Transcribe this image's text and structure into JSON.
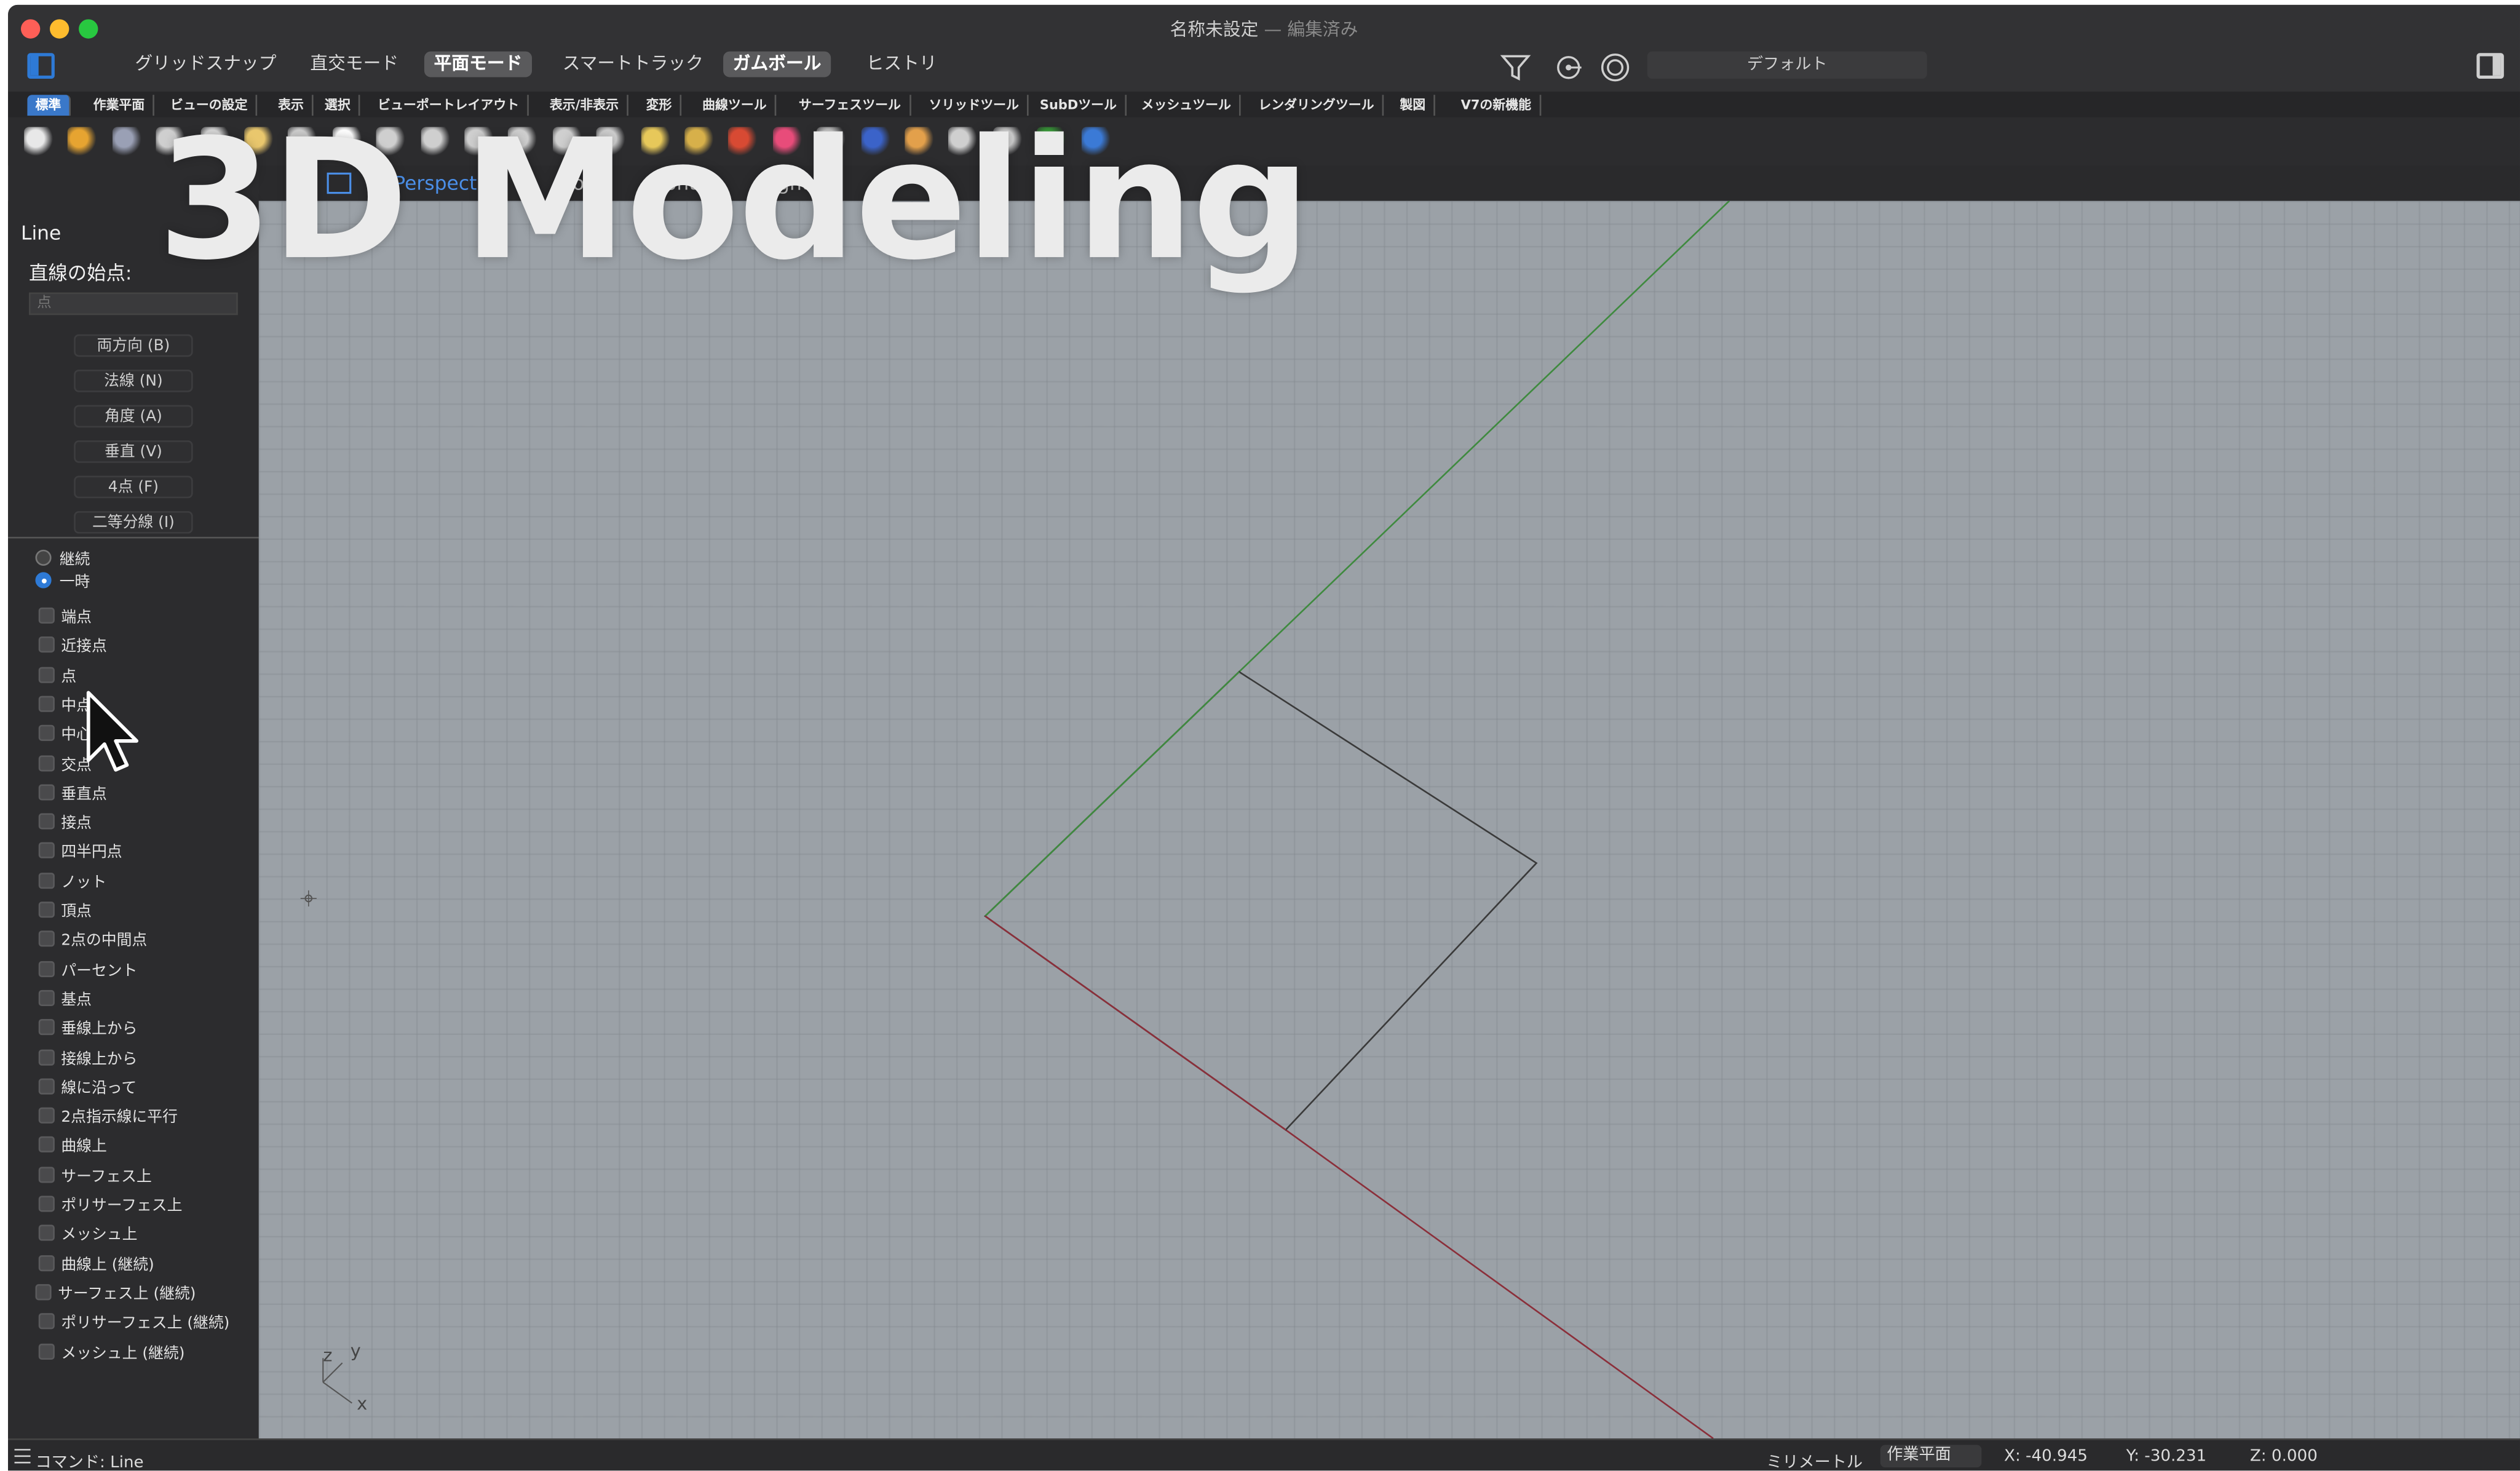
{
  "window": {
    "title": "名称未設定",
    "title_sep": " — ",
    "title_status": "編集済み"
  },
  "toolbar": {
    "grid_snap": "グリッドスナップ",
    "ortho": "直交モード",
    "planar": "平面モード",
    "smart_track": "スマートトラック",
    "gumball": "ガムボール",
    "history": "ヒストリ",
    "layer_default": "デフォルト"
  },
  "tabs": [
    "標準",
    "作業平面",
    "ビューの設定",
    "表示",
    "選択",
    "ビューポートレイアウト",
    "表示/非表示",
    "変形",
    "曲線ツール",
    "サーフェスツール",
    "ソリッドツール",
    "SubDツール",
    "メッシュツール",
    "レンダリングツール",
    "製図",
    "V7の新機能"
  ],
  "viewport_tabs": [
    "Perspective",
    "Top",
    "Front",
    "Right"
  ],
  "overlay_text": "3D Modeling",
  "command": {
    "name": "Line",
    "prompt": "直線の始点:",
    "input_placeholder": "点",
    "options": [
      "両方向 (B)",
      "法線 (N)",
      "角度 (A)",
      "垂直 (V)",
      "4点 (F)",
      "二等分線 (I)"
    ]
  },
  "osnap_mode": {
    "options": [
      "継続",
      "一時"
    ],
    "selected": "一時"
  },
  "osnaps": [
    "端点",
    "近接点",
    "点",
    "中点",
    "中心点",
    "交点",
    "垂直点",
    "接点",
    "四半円点",
    "ノット",
    "頂点",
    "2点の中間点",
    "パーセント",
    "基点",
    "垂線上から",
    "接線上から",
    "線に沿って",
    "2点指示線に平行",
    "曲線上",
    "サーフェス上",
    "ポリサーフェス上",
    "メッシュ上",
    "曲線上 (継続)",
    "サーフェス上 (継続)",
    "ポリサーフェス上 (継続)",
    "メッシュ上 (継続)"
  ],
  "axes": {
    "z": "z",
    "y": "y",
    "x": "x"
  },
  "status": {
    "command": "コマンド: Line",
    "units": "ミリメートル",
    "cplane": "作業平面",
    "x": "X: -40.945",
    "y": "Y: -30.231",
    "z": "Z: 0.000"
  },
  "colors": {
    "accent": "#2e7ad6",
    "viewport_bg": "#9ba1a7",
    "x_axis": "#8b2f3a",
    "y_axis": "#3f8a3f"
  }
}
